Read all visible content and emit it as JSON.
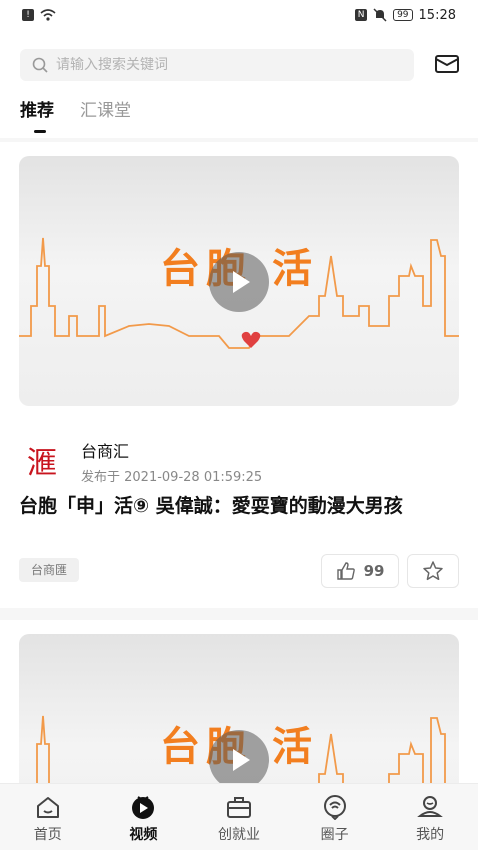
{
  "status_bar": {
    "time": "15:28",
    "battery": "99"
  },
  "search": {
    "placeholder": "请输入搜索关键词"
  },
  "tabs": [
    {
      "label": "推荐"
    },
    {
      "label": "汇课堂"
    }
  ],
  "feed": [
    {
      "thumbnail_title": "台胞 活",
      "publisher_name": "台商汇",
      "publisher_logo_text": "滙",
      "date": "发布于 2021-09-28 01:59:25",
      "title": "台胞「申」活⑨ 吳偉誠：愛耍寶的動漫大男孩",
      "tag": "台商匯",
      "likes": "99"
    },
    {
      "thumbnail_title": "台胞 活"
    }
  ],
  "bottom_nav": [
    {
      "label": "首页",
      "icon": "home-icon"
    },
    {
      "label": "视频",
      "icon": "video-icon"
    },
    {
      "label": "创就业",
      "icon": "briefcase-icon"
    },
    {
      "label": "圈子",
      "icon": "circle-chat-icon"
    },
    {
      "label": "我的",
      "icon": "profile-icon"
    }
  ],
  "colors": {
    "accent_orange": "#f27e1f",
    "logo_red": "#c8141e",
    "active_text": "#111111",
    "inactive_text": "#999999"
  }
}
